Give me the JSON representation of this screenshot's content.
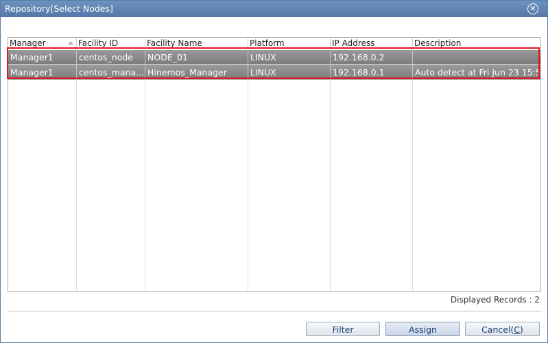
{
  "window": {
    "title": "Repository[Select Nodes]"
  },
  "table": {
    "columns": [
      "Manager",
      "Facility ID",
      "Facility Name",
      "Platform",
      "IP Address",
      "Description"
    ],
    "rows": [
      [
        "Manager1",
        "centos_node",
        "NODE_01",
        "LINUX",
        "192.168.0.2",
        ""
      ],
      [
        "Manager1",
        "centos_mana...",
        "Hinemos_Manager",
        "LINUX",
        "192.168.0.1",
        "Auto detect at Fri Jun 23 15:5"
      ]
    ]
  },
  "status": {
    "records": "Displayed Records : 2"
  },
  "buttons": {
    "filter": "Filter",
    "assign": "Assign",
    "cancel_prefix": "Cancel(",
    "cancel_key": "C",
    "cancel_suffix": ")"
  },
  "colors": {
    "titlebar": "#5f84b4",
    "selection": "#8a8a8a",
    "highlight_border": "#e0141e"
  }
}
